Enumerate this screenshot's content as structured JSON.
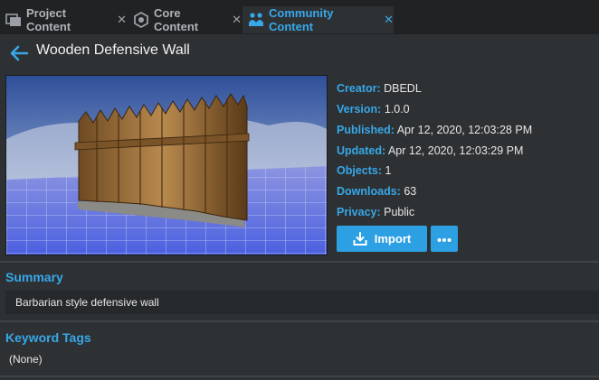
{
  "tabs": [
    {
      "label": "Project Content",
      "icon": "project-content-icon",
      "active": false
    },
    {
      "label": "Core Content",
      "icon": "core-content-icon",
      "active": false
    },
    {
      "label": "Community Content",
      "icon": "community-content-icon",
      "active": true
    }
  ],
  "header": {
    "title": "Wooden Defensive Wall"
  },
  "details": [
    {
      "key": "Creator:",
      "value": "DBEDL"
    },
    {
      "key": "Version:",
      "value": "1.0.0"
    },
    {
      "key": "Published:",
      "value": "Apr 12, 2020, 12:03:28 PM"
    },
    {
      "key": "Updated:",
      "value": "Apr 12, 2020, 12:03:29 PM"
    },
    {
      "key": "Objects:",
      "value": "1"
    },
    {
      "key": "Downloads:",
      "value": "63"
    },
    {
      "key": "Privacy:",
      "value": "Public"
    }
  ],
  "actions": {
    "import_label": "Import"
  },
  "summary": {
    "title": "Summary",
    "text": "Barbarian style defensive wall"
  },
  "keyword_tags": {
    "title": "Keyword Tags",
    "value": "(None)"
  },
  "colors": {
    "accent": "#36a8ea",
    "button": "#2d9fe3",
    "background": "#2e3133",
    "tabbar": "#202224"
  }
}
